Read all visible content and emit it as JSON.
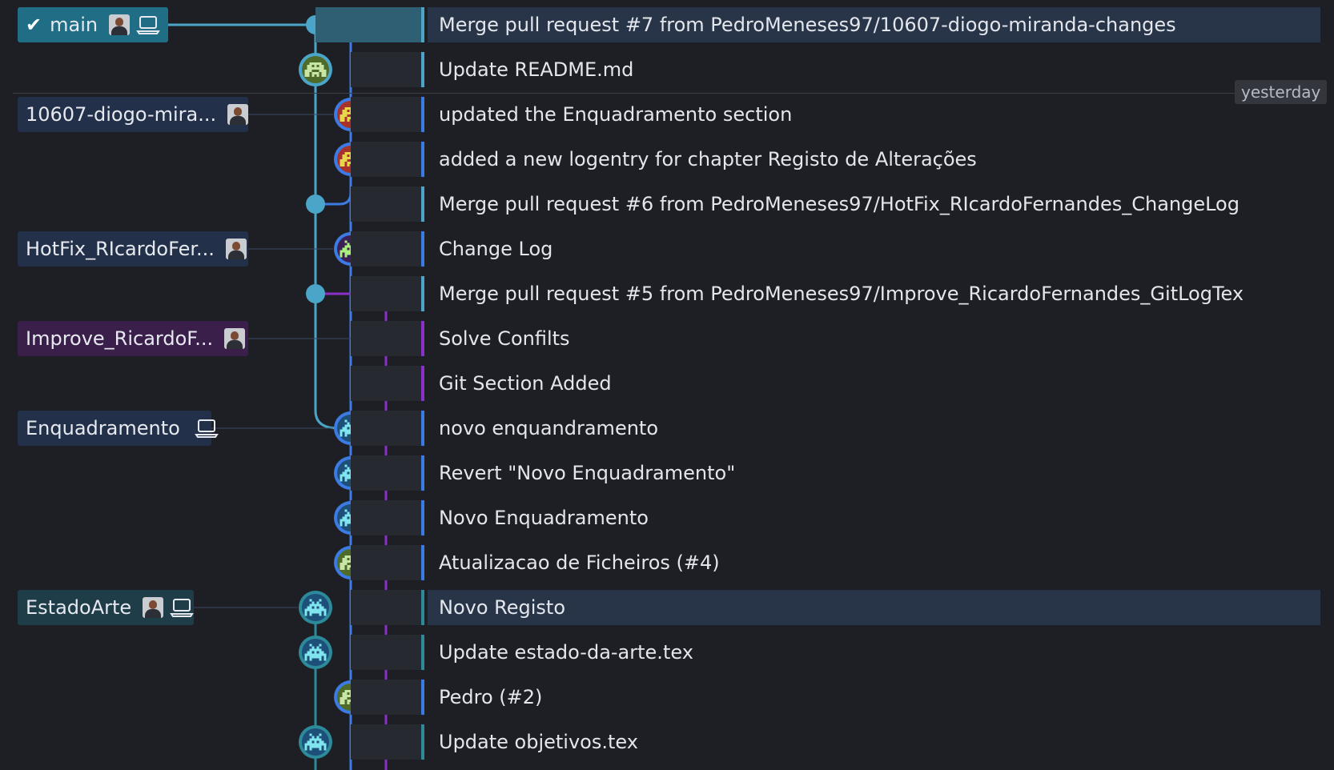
{
  "date_separator": "yesterday",
  "colors": {
    "main": "#4aa5c9",
    "blue": "#3c7be3",
    "purple": "#8a2fc9",
    "teal": "#2d8a9a",
    "label_main": "#1f6e85",
    "label_blue": "#23304a",
    "label_purple": "#3a1f4a",
    "label_teal": "#1f3d48"
  },
  "branches": [
    {
      "name": "main",
      "checked_out": true,
      "has_avatar": true,
      "has_laptop": true
    },
    {
      "name": "10607-diogo-mira...",
      "has_avatar": true
    },
    {
      "name": "HotFix_RIcardoFer...",
      "has_avatar": true
    },
    {
      "name": "Improve_RicardoF...",
      "has_avatar": true
    },
    {
      "name": "Enquadramento",
      "has_laptop": true
    },
    {
      "name": "EstadoArte",
      "has_avatar": true,
      "has_laptop": true
    }
  ],
  "commits": [
    {
      "message": "Merge pull request #7 from PedroMeneses97/10607-diogo-miranda-changes",
      "node_type": "merge",
      "lane": "main",
      "selected": true,
      "avatar_style": "none"
    },
    {
      "message": "Update README.md",
      "node_type": "avatar",
      "lane": "main",
      "avatar_style": "green"
    },
    {
      "message": "updated the Enquadramento section",
      "node_type": "avatar",
      "lane": "blue",
      "avatar_style": "red"
    },
    {
      "message": "added a new logentry for chapter Registo de Alterações",
      "node_type": "avatar",
      "lane": "blue",
      "avatar_style": "red"
    },
    {
      "message": "Merge pull request #6 from PedroMeneses97/HotFix_RIcardoFernandes_ChangeLog",
      "node_type": "merge",
      "lane": "main",
      "avatar_style": "none"
    },
    {
      "message": "Change Log",
      "node_type": "avatar",
      "lane": "blue",
      "avatar_style": "invader-green"
    },
    {
      "message": "Merge pull request #5 from PedroMeneses97/Improve_RicardoFernandes_GitLogTex",
      "node_type": "merge",
      "lane": "main",
      "avatar_style": "none"
    },
    {
      "message": "Solve Confilts",
      "node_type": "avatar",
      "lane": "purple",
      "avatar_style": "invader-green"
    },
    {
      "message": "Git Section Added",
      "node_type": "avatar",
      "lane": "purple",
      "avatar_style": "invader-green"
    },
    {
      "message": "novo enquandramento",
      "node_type": "avatar",
      "lane": "blue",
      "avatar_style": "invader-cyan"
    },
    {
      "message": "Revert \"Novo Enquadramento\"",
      "node_type": "avatar",
      "lane": "blue",
      "avatar_style": "invader-cyan"
    },
    {
      "message": "Novo Enquadramento",
      "node_type": "avatar",
      "lane": "blue",
      "avatar_style": "invader-cyan"
    },
    {
      "message": "Atualizacao de Ficheiros (#4)",
      "node_type": "avatar",
      "lane": "blue",
      "avatar_style": "green"
    },
    {
      "message": "Novo Registo",
      "node_type": "avatar",
      "lane": "teal",
      "selected": true,
      "avatar_style": "invader-cyan"
    },
    {
      "message": "Update estado-da-arte.tex",
      "node_type": "avatar",
      "lane": "teal",
      "avatar_style": "invader-cyan"
    },
    {
      "message": "Pedro (#2)",
      "node_type": "avatar",
      "lane": "blue",
      "avatar_style": "green"
    },
    {
      "message": "Update objetivos.tex",
      "node_type": "avatar",
      "lane": "teal",
      "avatar_style": "invader-cyan"
    }
  ]
}
